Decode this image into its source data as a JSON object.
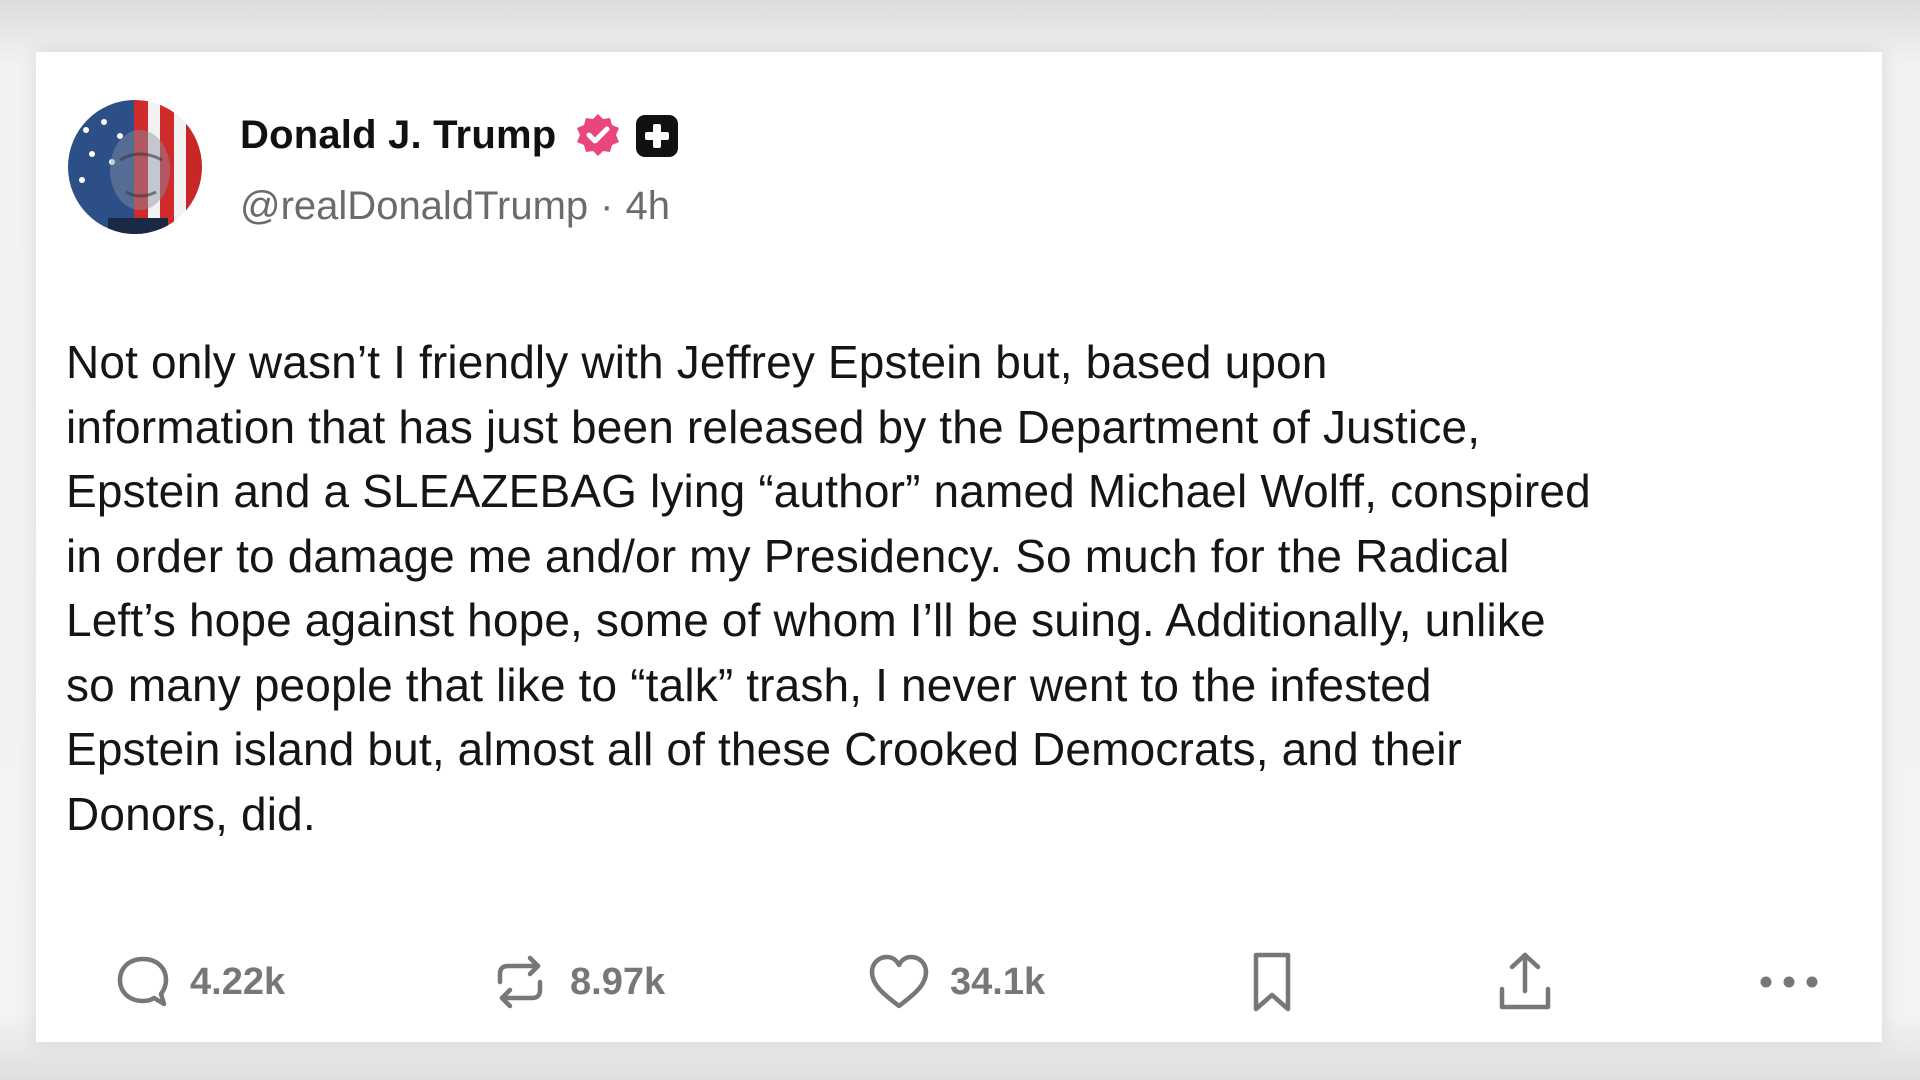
{
  "post": {
    "author": {
      "display_name": "Donald J. Trump",
      "handle": "@realDonaldTrump",
      "separator": "·",
      "time_ago": "4h",
      "avatar_icon": "american-flag-portrait-avatar",
      "verified_icon": "verified-badge-icon",
      "verified_color": "#e8467c",
      "plus_badge_icon": "plus-badge-icon"
    },
    "body": "Not only wasn’t I friendly with Jeffrey Epstein but, based upon\ninformation that has just been released by the Department of Justice,\nEpstein and a SLEAZEBAG lying “author” named Michael Wolff, conspired\nin order to damage me and/or my Presidency. So much for the Radical\nLeft’s hope against hope, some of whom I’ll be suing. Additionally, unlike\nso many people that like to “talk” trash, I never went to the infested\nEpstein island but, almost all of these Crooked Democrats, and their\nDonors, did.",
    "actions": {
      "replies": {
        "icon": "reply-bubble-icon",
        "count": "4.22k"
      },
      "reposts": {
        "icon": "repost-icon",
        "count": "8.97k"
      },
      "likes": {
        "icon": "heart-icon",
        "count": "34.1k"
      },
      "bookmark": {
        "icon": "bookmark-icon"
      },
      "share": {
        "icon": "share-upload-icon"
      },
      "more": {
        "icon": "more-dots-icon"
      }
    },
    "colors": {
      "text": "#151515",
      "muted": "#6b6b6b",
      "action_icon": "#777777"
    }
  }
}
